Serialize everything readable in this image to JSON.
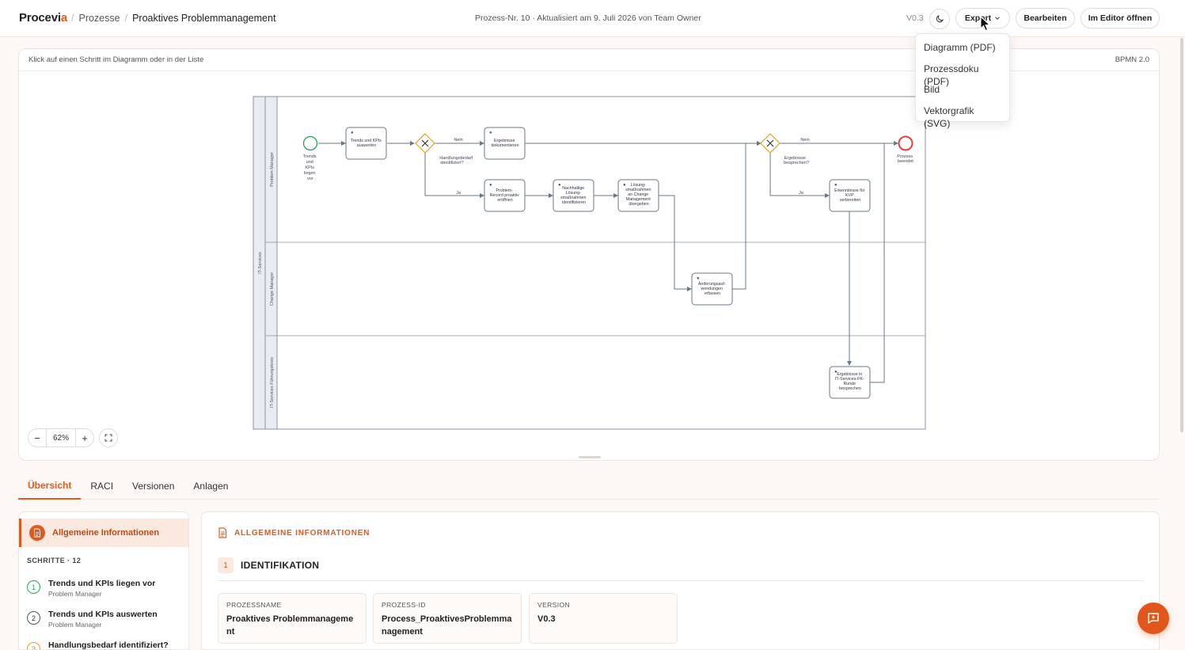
{
  "header": {
    "logo_main": "Procevi",
    "logo_accent": "a",
    "breadcrumb_root": "Prozesse",
    "breadcrumb_current": "Proaktives Problemmanagement",
    "meta": "Prozess-Nr. 10 · Aktualisiert am 9. Juli 2026 von Team Owner",
    "version": "V0.3",
    "export_label": "Export",
    "edit_label": "Bearbeiten",
    "editor_label": "Im Editor öffnen"
  },
  "export_menu": [
    "Diagramm (PDF)",
    "Prozessdoku (PDF)",
    "Bild",
    "Vektorgrafik (SVG)"
  ],
  "diagram": {
    "hint": "Klick auf einen Schritt im Diagramm oder in der Liste",
    "format": "BPMN 2.0",
    "zoom": "62%",
    "zoom_minus": "−",
    "zoom_plus": "+",
    "pool": "IT-Services",
    "lanes": [
      "Problem Manager",
      "Change Manager",
      "IT-Services Führungskreis"
    ],
    "start_event": [
      "Trends",
      "und",
      "KPIs",
      "liegen",
      "vor"
    ],
    "end_event": [
      "Prozess",
      "beendet"
    ],
    "tasks": {
      "t1": [
        "Trends und KPIs",
        "auswerten"
      ],
      "t2": [
        "Ergebnisse",
        "dokumentieren"
      ],
      "t3": [
        "Problem-",
        "Record proaktiv",
        "eröffnen"
      ],
      "t4": [
        "Nachhaltige",
        "Lösung-",
        "smaßnahmen",
        "identifizieren"
      ],
      "t5": [
        "Lösung-",
        "smaßnahmen",
        "an Change",
        "Management",
        "übergeben"
      ],
      "t6": [
        "Änderungsauf-",
        "wendungen",
        "erfassen"
      ],
      "t7": [
        "Erkenntnisse für",
        "KVP",
        "verbereiten"
      ],
      "t8": [
        "Ergebnisse in",
        "IT-Services-FK-",
        "Runde",
        "besprechen"
      ]
    },
    "gateway1": [
      "Handlungsbedarf",
      "identifiziert?"
    ],
    "gateway2": [
      "Ergebnisse",
      "besprechen?"
    ],
    "flow_no": "Nein",
    "flow_yes": "Ja",
    "colors": {
      "start": "#2aa35a",
      "end": "#e04040",
      "gateway": "#e0a020",
      "stroke": "#6b7785"
    }
  },
  "tabs": [
    "Übersicht",
    "RACI",
    "Versionen",
    "Anlagen"
  ],
  "sidebar": {
    "active_label": "Allgemeine Informationen",
    "steps_heading": "SCHRITTE · 12",
    "steps": [
      {
        "num": "1",
        "title": "Trends und KPIs liegen vor",
        "role": "Problem Manager"
      },
      {
        "num": "2",
        "title": "Trends und KPIs auswerten",
        "role": "Problem Manager"
      },
      {
        "num": "3",
        "title": "Handlungsbedarf identifiziert?",
        "role": ""
      }
    ]
  },
  "panel": {
    "heading": "ALLGEMEINE INFORMATIONEN",
    "section_num": "1",
    "section_title": "IDENTIFIKATION",
    "fields": [
      {
        "label": "PROZESSNAME",
        "value": "Proaktives Problemmanagement"
      },
      {
        "label": "PROZESS-ID",
        "value": "Process_ProaktivesProblemmanagement"
      },
      {
        "label": "VERSION",
        "value": "V0.3"
      }
    ]
  },
  "icons": {
    "theme": "moon-icon",
    "export_caret": "chevron-down-icon",
    "fit": "fullscreen-icon",
    "doc": "document-icon",
    "fab": "chat-icon",
    "task": "user-icon"
  },
  "accent_color": "#e05a1f"
}
